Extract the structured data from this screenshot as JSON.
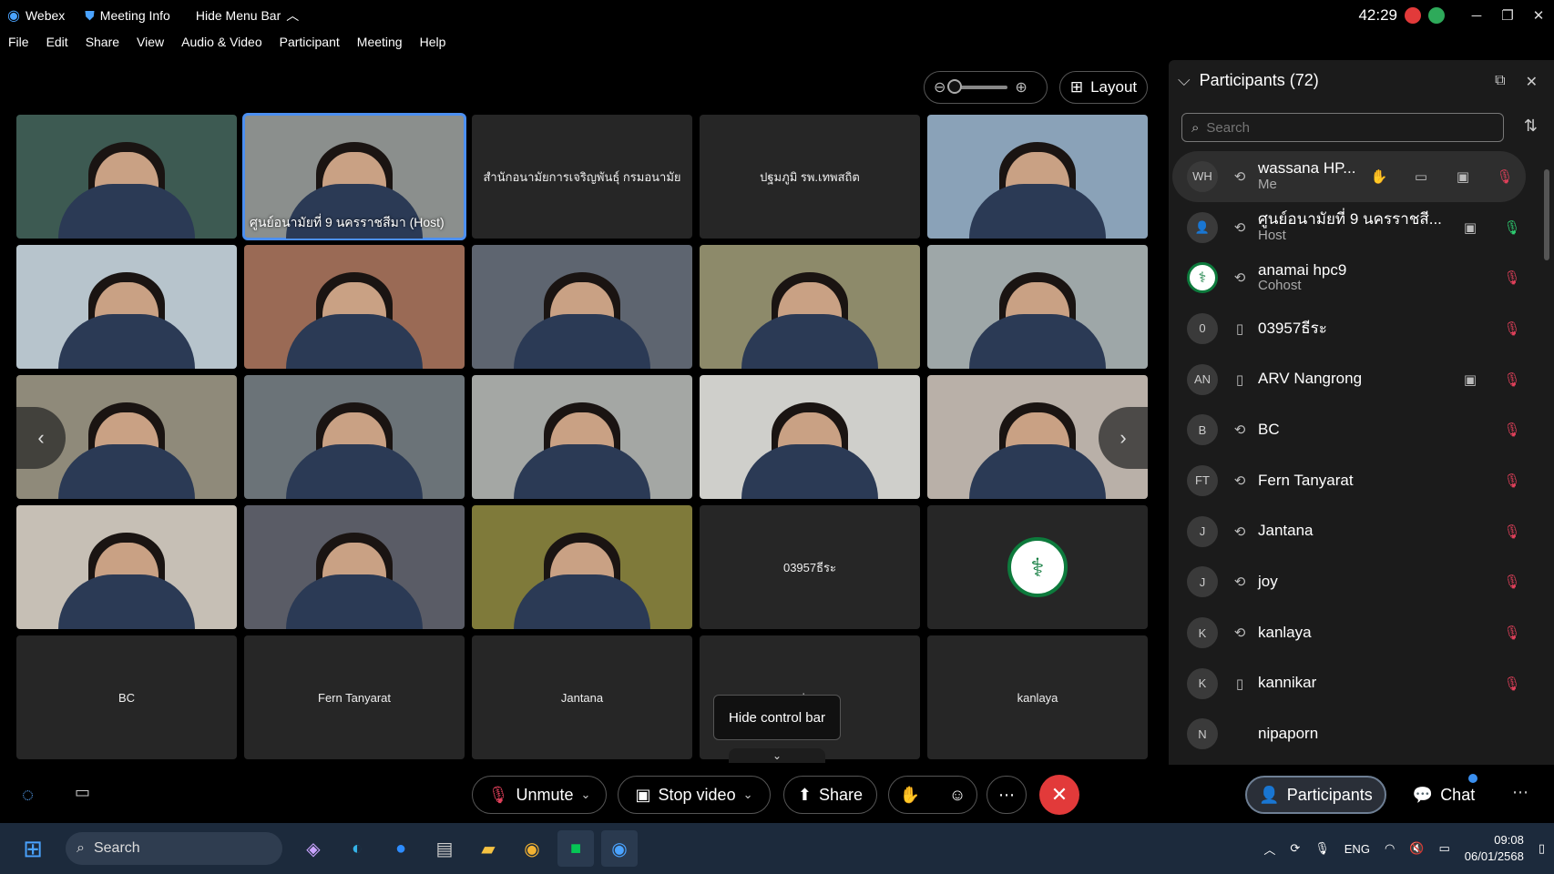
{
  "titlebar": {
    "app_name": "Webex",
    "meeting_info": "Meeting Info",
    "hide_menu_bar": "Hide Menu Bar",
    "timer": "42:29"
  },
  "menubar": [
    "File",
    "Edit",
    "Share",
    "View",
    "Audio & Video",
    "Participant",
    "Meeting",
    "Help"
  ],
  "layout_button": "Layout",
  "tiles": [
    {
      "type": "video",
      "caption": "",
      "tone": "#3d5a52"
    },
    {
      "type": "video",
      "caption": "ศูนย์อนามัยที่ 9 นครราชสีมา (Host)",
      "tone": "#8b8f8d",
      "host": true
    },
    {
      "type": "name",
      "name": "สำนักอนามัยการเจริญพันธุ์ กรมอนามัย"
    },
    {
      "type": "name",
      "name": "ปฐมภูมิ รพ.เทพสถิต"
    },
    {
      "type": "video",
      "caption": "",
      "tone": "#8aa2b8"
    },
    {
      "type": "video",
      "caption": "",
      "tone": "#b7c4cc"
    },
    {
      "type": "video",
      "caption": "",
      "tone": "#9a6a55"
    },
    {
      "type": "video",
      "caption": "",
      "tone": "#5e6570"
    },
    {
      "type": "video",
      "caption": "",
      "tone": "#8d8a6a"
    },
    {
      "type": "video",
      "caption": "",
      "tone": "#9ea7a8"
    },
    {
      "type": "video",
      "caption": "",
      "tone": "#8f8a7a"
    },
    {
      "type": "video",
      "caption": "",
      "tone": "#6b7378"
    },
    {
      "type": "video",
      "caption": "",
      "tone": "#a4a7a4"
    },
    {
      "type": "video",
      "caption": "",
      "tone": "#cfcfcb"
    },
    {
      "type": "video",
      "caption": "",
      "tone": "#b9b0a8"
    },
    {
      "type": "video",
      "caption": "",
      "tone": "#c6bfb5"
    },
    {
      "type": "video",
      "caption": "",
      "tone": "#5a5c66"
    },
    {
      "type": "video",
      "caption": "",
      "tone": "#7f7a3a"
    },
    {
      "type": "name",
      "name": "03957ธีระ"
    },
    {
      "type": "logo",
      "name": ""
    },
    {
      "type": "name",
      "name": "BC"
    },
    {
      "type": "name",
      "name": "Fern Tanyarat"
    },
    {
      "type": "name",
      "name": "Jantana"
    },
    {
      "type": "name",
      "name": "joy"
    },
    {
      "type": "name",
      "name": "kanlaya"
    }
  ],
  "tooltip": "Hide control bar",
  "participants_panel": {
    "title": "Participants (72)",
    "search_placeholder": "Search",
    "list": [
      {
        "initials": "WH",
        "name": "wassana HP...",
        "role": "Me",
        "device": "sync",
        "icons": [
          "hand",
          "cc",
          "video",
          "mute"
        ]
      },
      {
        "initials": "",
        "name": "ศูนย์อนามัยที่ 9 นครราชสี...",
        "role": "Host",
        "device": "sync",
        "icons": [
          "video",
          "unmuted"
        ]
      },
      {
        "initials": "",
        "name": "anamai hpc9",
        "role": "Cohost",
        "device": "sync",
        "icons": [
          "mute"
        ],
        "logo": true
      },
      {
        "initials": "0",
        "name": "03957ธีระ",
        "role": "",
        "device": "phone",
        "icons": [
          "mute"
        ]
      },
      {
        "initials": "AN",
        "name": "ARV Nangrong",
        "role": "",
        "device": "phone",
        "icons": [
          "video",
          "mute"
        ]
      },
      {
        "initials": "B",
        "name": "BC",
        "role": "",
        "device": "sync",
        "icons": [
          "mute"
        ]
      },
      {
        "initials": "FT",
        "name": "Fern Tanyarat",
        "role": "",
        "device": "sync",
        "icons": [
          "mute"
        ]
      },
      {
        "initials": "J",
        "name": "Jantana",
        "role": "",
        "device": "sync",
        "icons": [
          "mute"
        ]
      },
      {
        "initials": "J",
        "name": "joy",
        "role": "",
        "device": "sync",
        "icons": [
          "mute"
        ]
      },
      {
        "initials": "K",
        "name": "kanlaya",
        "role": "",
        "device": "sync",
        "icons": [
          "mute"
        ]
      },
      {
        "initials": "K",
        "name": "kannikar",
        "role": "",
        "device": "phone",
        "icons": [
          "mute"
        ]
      },
      {
        "initials": "N",
        "name": "nipaporn",
        "role": "",
        "device": "",
        "icons": []
      }
    ]
  },
  "controls": {
    "unmute": "Unmute",
    "stop_video": "Stop video",
    "share": "Share",
    "participants": "Participants",
    "chat": "Chat"
  },
  "taskbar": {
    "search": "Search",
    "lang": "ENG",
    "time": "09:08",
    "date": "06/01/2568"
  },
  "colors": {
    "accent": "#4c8ff0",
    "end_call": "#e23a3a",
    "mute": "#e0405a",
    "brand_green": "#0d7a3c"
  }
}
